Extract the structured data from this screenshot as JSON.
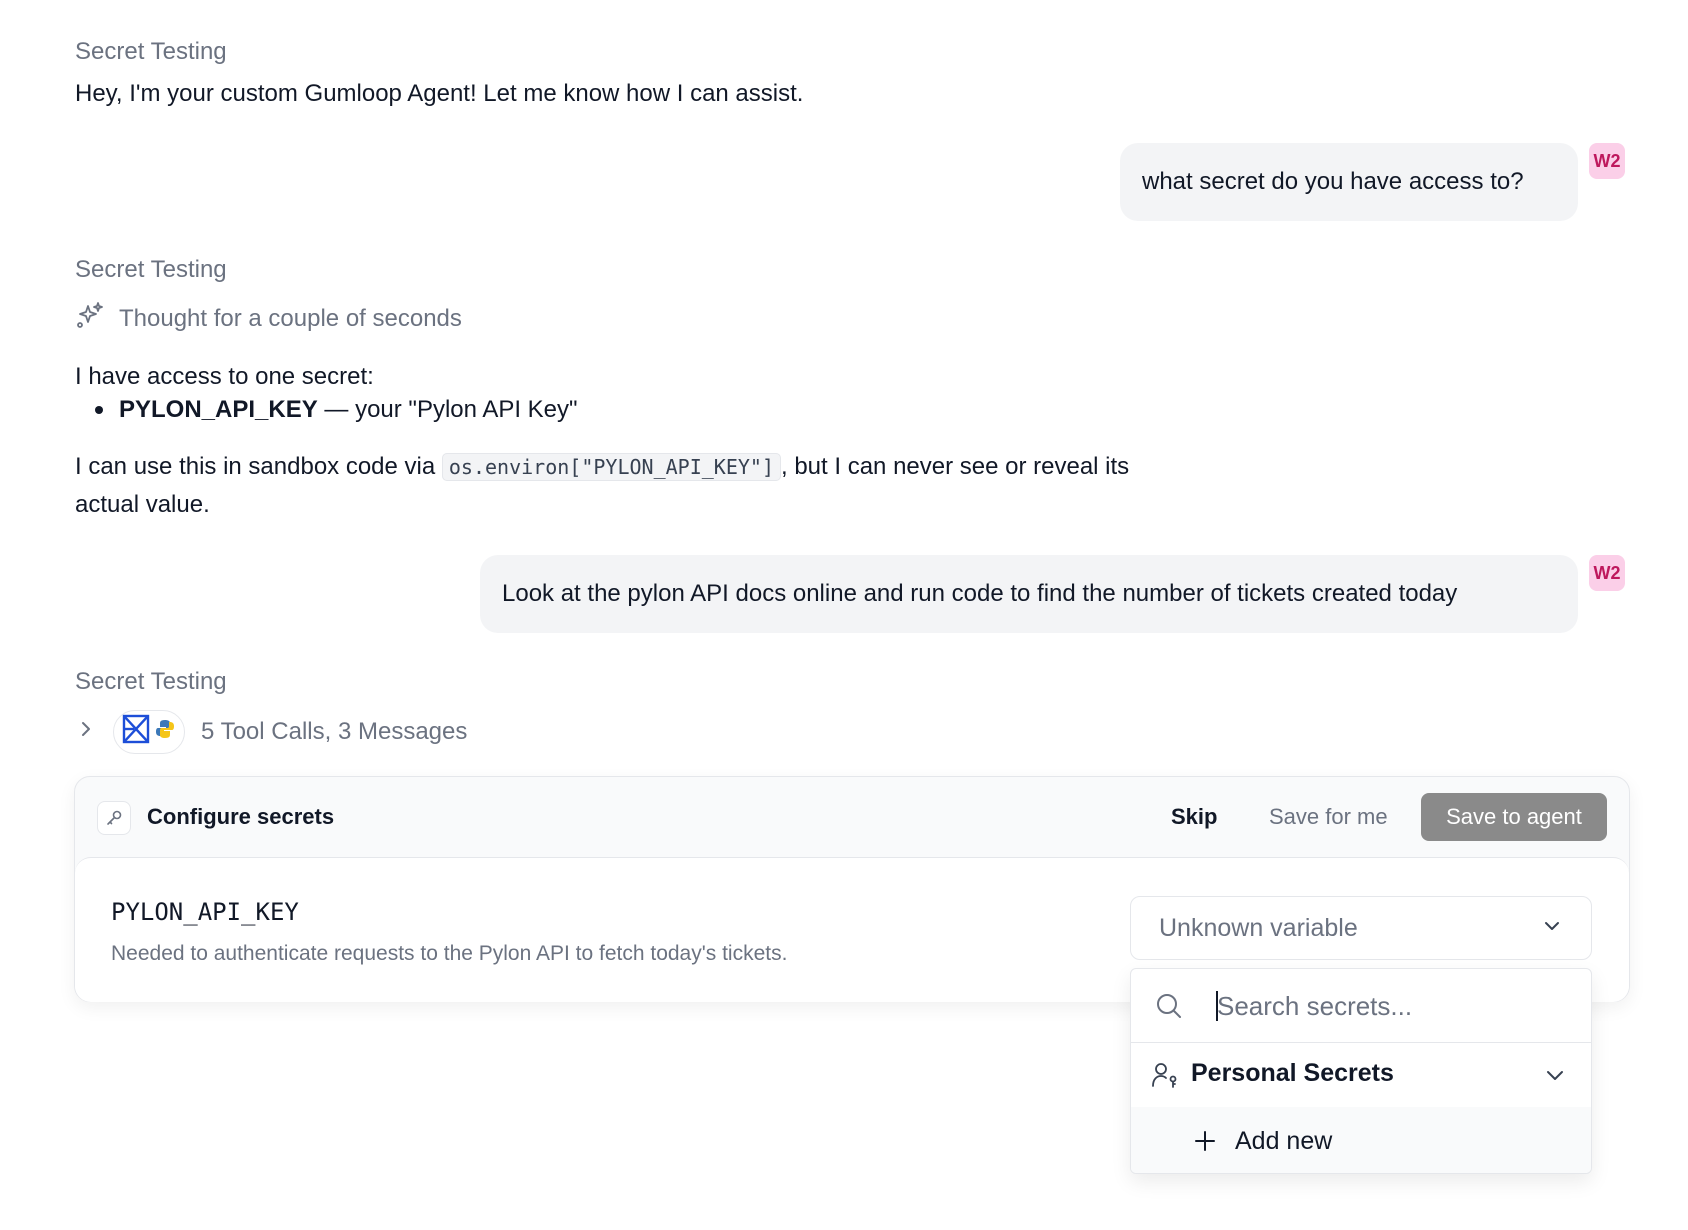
{
  "messages": {
    "agent_name": "Secret Testing",
    "greeting": "Hey, I'm your custom Gumloop Agent! Let me know how I can assist.",
    "user_q1": "what secret do you have access to?",
    "avatar_label": "W2",
    "thought": "Thought for a couple of seconds",
    "access_intro": "I have access to one secret:",
    "secret_key": "PYLON_API_KEY",
    "secret_key_desc": " — your \"Pylon API Key\"",
    "usage_prefix": "I can use this in sandbox code via ",
    "usage_code": "os.environ[\"PYLON_API_KEY\"]",
    "usage_suffix": ", but I can never see or reveal its",
    "usage_line2": "actual value.",
    "user_q2": "Look at the pylon API docs online and run code to find the number of tickets created today",
    "tool_summary": "5 Tool Calls, 3 Messages"
  },
  "secrets_card": {
    "title": "Configure secrets",
    "skip_label": "Skip",
    "save_me_label": "Save for me",
    "save_agent_label": "Save to agent",
    "var_name": "PYLON_API_KEY",
    "var_desc": "Needed to authenticate requests to the Pylon API to fetch today's tickets.",
    "select_value": "Unknown variable"
  },
  "dropdown": {
    "search_placeholder": "Search secrets...",
    "group_label": "Personal Secrets",
    "add_label": "Add new"
  },
  "colors": {
    "avatar_bg": "#fbcfe8",
    "avatar_text": "#be185d",
    "save_agent_bg": "#8a8a8a",
    "tool_icon_blue": "#1d4ed8"
  }
}
